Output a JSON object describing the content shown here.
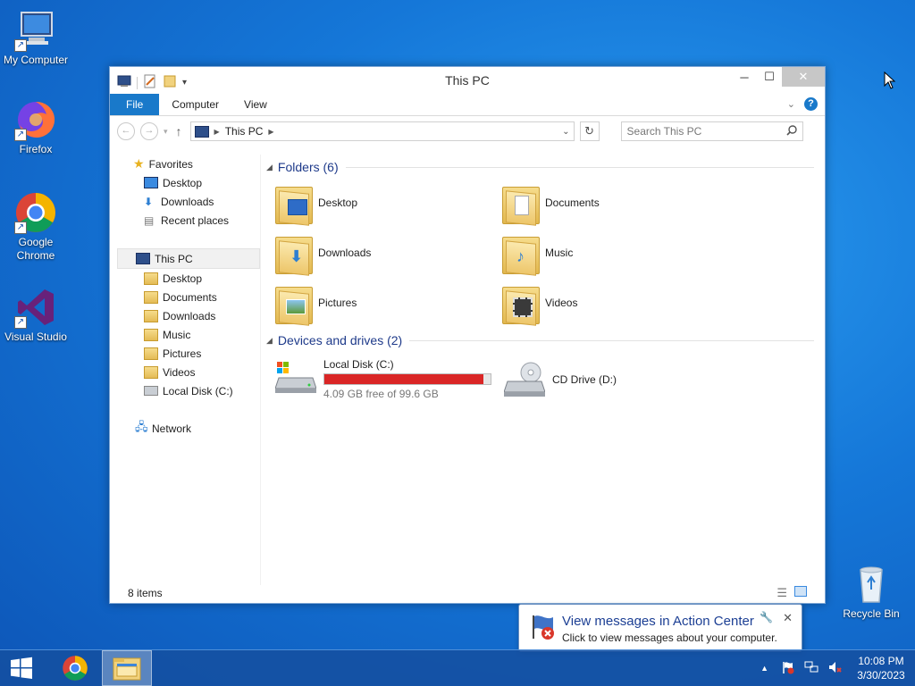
{
  "desktop": {
    "icons": [
      {
        "label": "My Computer",
        "icon": "computer-icon"
      },
      {
        "label": "Firefox",
        "icon": "firefox-icon"
      },
      {
        "label": "Google Chrome",
        "icon": "chrome-icon"
      },
      {
        "label": "Visual Studio",
        "icon": "visual-studio-icon"
      },
      {
        "label": "Recycle Bin",
        "icon": "recycle-bin-icon"
      }
    ]
  },
  "window": {
    "title": "This PC",
    "ribbon_tabs": [
      "File",
      "Computer",
      "View"
    ],
    "address": "This PC",
    "search_placeholder": "Search This PC",
    "nav": {
      "favorites": "Favorites",
      "favorites_items": [
        "Desktop",
        "Downloads",
        "Recent places"
      ],
      "this_pc": "This PC",
      "this_pc_items": [
        "Desktop",
        "Documents",
        "Downloads",
        "Music",
        "Pictures",
        "Videos",
        "Local Disk (C:)"
      ],
      "network": "Network"
    },
    "groups": {
      "folders_header": "Folders (6)",
      "folders": [
        "Desktop",
        "Documents",
        "Downloads",
        "Music",
        "Pictures",
        "Videos"
      ],
      "drives_header": "Devices and drives (2)",
      "drive_c": {
        "label": "Local Disk (C:)",
        "free_text": "4.09 GB free of 99.6 GB",
        "used_fraction": 0.959
      },
      "drive_d": {
        "label": "CD Drive (D:)"
      }
    },
    "status": "8 items"
  },
  "balloon": {
    "title": "View messages in Action Center",
    "text": "Click to view messages about your computer."
  },
  "taskbar": {
    "time": "10:08 PM",
    "date": "3/30/2023"
  },
  "colors": {
    "accent": "#1979ca",
    "disk_bar": "#da2626"
  }
}
